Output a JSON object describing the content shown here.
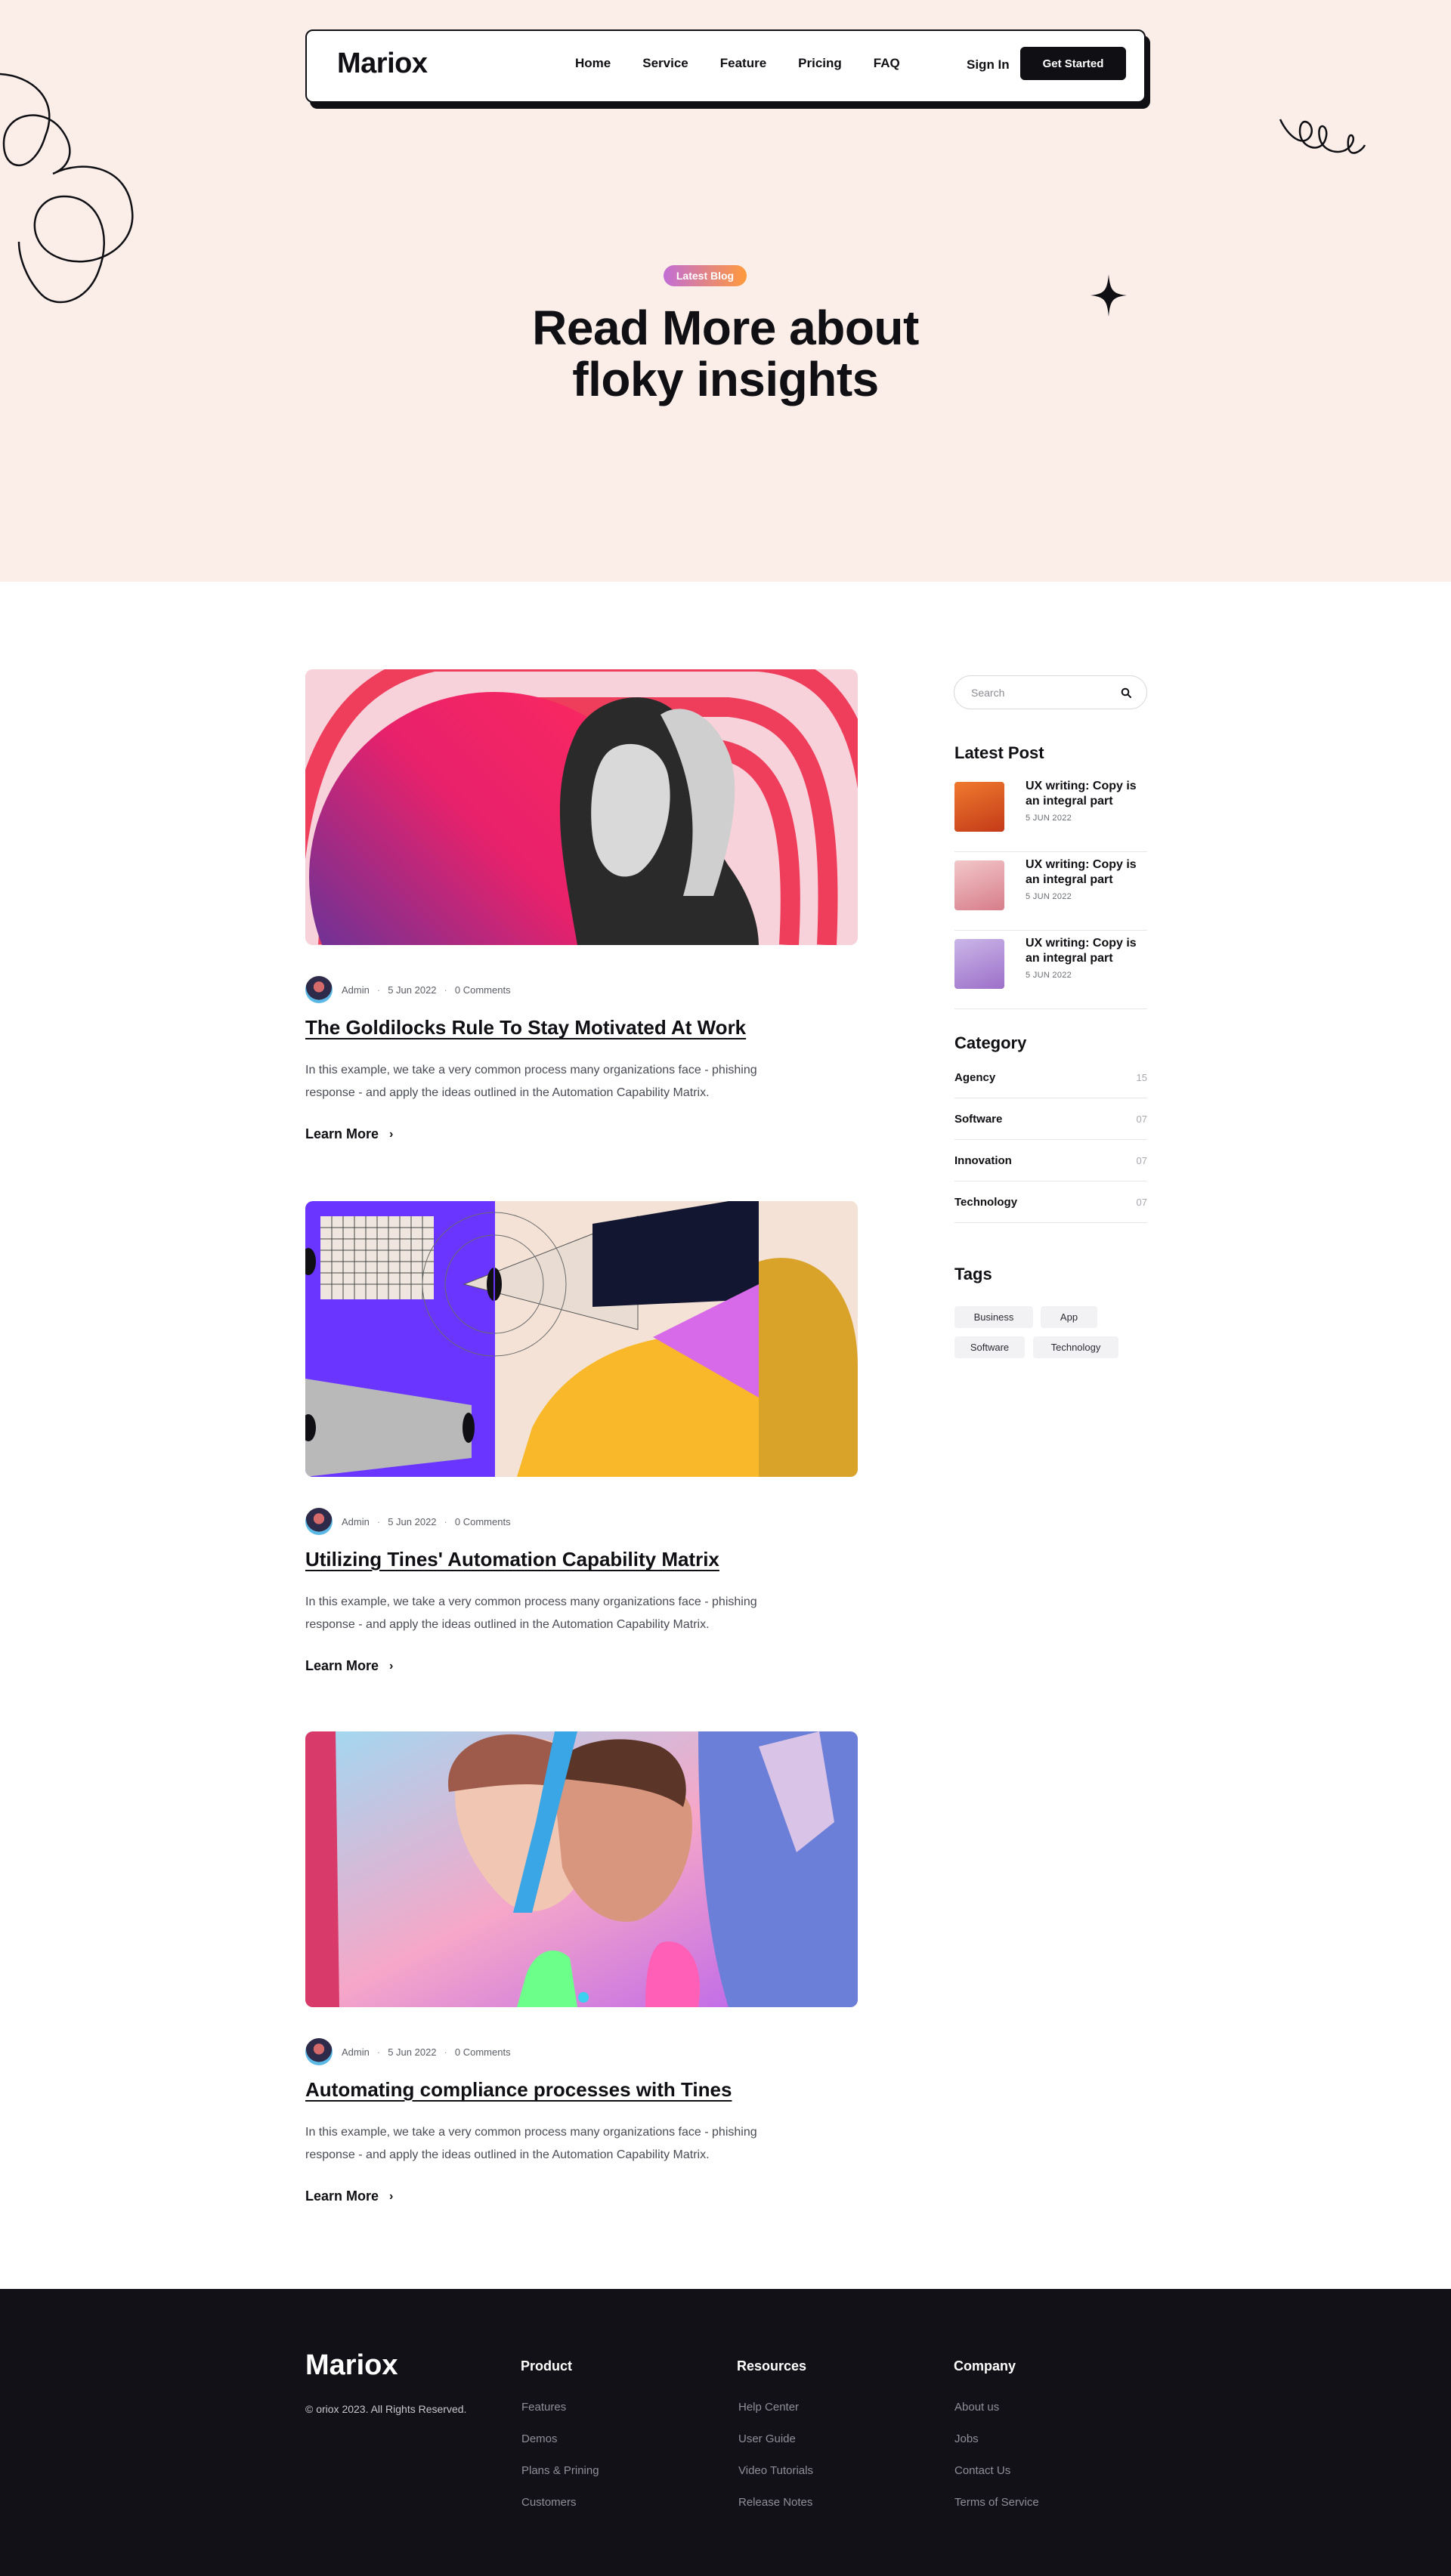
{
  "nav": {
    "logo": "Mariox",
    "links": [
      "Home",
      "Service",
      "Feature",
      "Pricing",
      "FAQ"
    ],
    "signin": "Sign In",
    "cta": "Get Started"
  },
  "hero": {
    "badge": "Latest Blog",
    "title_line1": "Read More about",
    "title_line2": "floky insights"
  },
  "posts": [
    {
      "author": "Admin",
      "date": "5 Jun 2022",
      "comments": "0 Comments",
      "title": "The Goldilocks Rule To Stay Motivated At Work",
      "excerpt": "In this example, we take a very common process many organizations face - phishing response - and apply the ideas outlined in the Automation Capability Matrix.",
      "cta": "Learn More"
    },
    {
      "author": "Admin",
      "date": "5 Jun 2022",
      "comments": "0 Comments",
      "title": "Utilizing Tines' Automation Capability Matrix",
      "excerpt": "In this example, we take a very common process many organizations face - phishing response - and apply the ideas outlined in the Automation Capability Matrix.",
      "cta": "Learn More"
    },
    {
      "author": "Admin",
      "date": "5 Jun 2022",
      "comments": "0 Comments",
      "title": "Automating compliance processes with Tines",
      "excerpt": "In this example, we take a very common process many organizations face - phishing response - and apply the ideas outlined in the Automation Capability Matrix.",
      "cta": "Learn More"
    }
  ],
  "sidebar": {
    "search_placeholder": "Search",
    "latest_heading": "Latest Post",
    "latest": [
      {
        "title": "UX writing: Copy is an integral part",
        "date": "5 JUN 2022"
      },
      {
        "title": "UX writing: Copy is an integral part",
        "date": "5 JUN 2022"
      },
      {
        "title": "UX writing: Copy is an integral part",
        "date": "5 JUN 2022"
      }
    ],
    "category_heading": "Category",
    "categories": [
      {
        "name": "Agency",
        "count": "15"
      },
      {
        "name": "Software",
        "count": "07"
      },
      {
        "name": "Innovation",
        "count": "07"
      },
      {
        "name": "Technology",
        "count": "07"
      }
    ],
    "tags_heading": "Tags",
    "tags": [
      "Business",
      "App",
      "Software",
      "Technology"
    ]
  },
  "footer": {
    "logo": "Mariox",
    "copyright": "© oriox 2023. All Rights Reserved.",
    "columns": [
      {
        "heading": "Product",
        "links": [
          "Features",
          "Demos",
          "Plans & Prining",
          "Customers"
        ]
      },
      {
        "heading": "Resources",
        "links": [
          "Help Center",
          "User Guide",
          "Video Tutorials",
          "Release Notes"
        ]
      },
      {
        "heading": "Company",
        "links": [
          "About us",
          "Jobs",
          "Contact Us",
          "Terms of Service"
        ]
      }
    ]
  },
  "colors": {
    "hero_bg": "#fbeee9",
    "dark": "#0f0f14",
    "footer_bg": "#121117",
    "badge_gradient_start": "#c26dd6",
    "badge_gradient_end": "#ff9a3c"
  }
}
